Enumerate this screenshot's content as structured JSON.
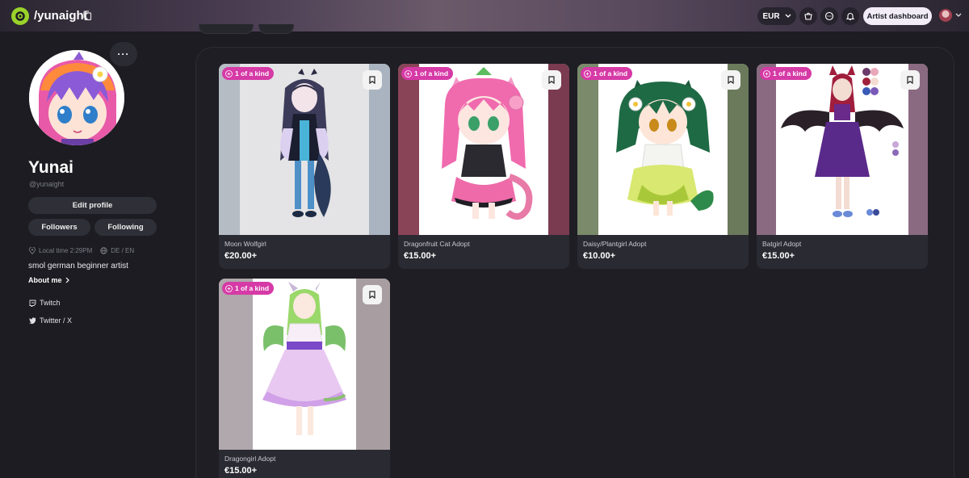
{
  "header": {
    "site_name": "/yunaight",
    "currency": "EUR",
    "artist_dashboard_label": "Artist dashboard"
  },
  "profile": {
    "name": "Yunai",
    "handle": "@yunaight",
    "more_label": "···",
    "edit_profile_label": "Edit profile",
    "followers_label": "Followers",
    "following_label": "Following",
    "local_time": "Local time 2:29PM",
    "languages": "DE / EN",
    "bio": "smol german beginner artist",
    "about_label": "About me",
    "links": [
      {
        "label": "Twitch",
        "icon": "twitch-icon"
      },
      {
        "label": "Twitter / X",
        "icon": "twitter-icon"
      }
    ]
  },
  "listings": [
    {
      "badge": "1 of a kind",
      "title": "Moon Wolfgirl",
      "price": "€20.00+"
    },
    {
      "badge": "1 of a kind",
      "title": "Dragonfruit Cat Adopt",
      "price": "€15.00+"
    },
    {
      "badge": "1 of a kind",
      "title": "Daisy/Plantgirl Adopt",
      "price": "€10.00+"
    },
    {
      "badge": "1 of a kind",
      "title": "Batgirl Adopt",
      "price": "€15.00+"
    },
    {
      "badge": "1 of a kind",
      "title": "Dragongirl Adopt",
      "price": "€15.00+"
    }
  ],
  "colors": {
    "background": "#1c1c22",
    "accent_badge": "#d63aa6",
    "logo_green": "#9ad22a"
  }
}
